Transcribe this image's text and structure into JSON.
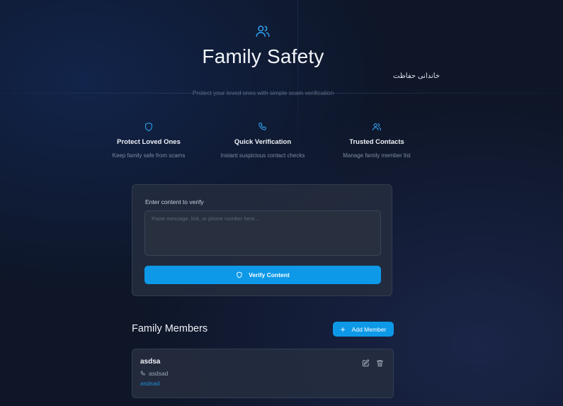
{
  "hero": {
    "icon": "users-icon",
    "title": "Family Safety",
    "title_translation": "خاندانی حفاظت",
    "subtitle": "Protect your loved ones with simple scam verification",
    "accent_color": "#2ea3f2"
  },
  "features": [
    {
      "icon": "shield-icon",
      "title": "Protect Loved Ones",
      "description": "Keep family safe from scams"
    },
    {
      "icon": "phone-icon",
      "title": "Quick Verification",
      "description": "Instant suspicious contact checks"
    },
    {
      "icon": "users-icon",
      "title": "Trusted Contacts",
      "description": "Manage family member list"
    }
  ],
  "verify": {
    "label": "Enter content to verify",
    "placeholder": "Paste message, link, or phone number here...",
    "value": "",
    "button_label": "Verify Content",
    "button_color": "#0d99e8"
  },
  "members": {
    "title": "Family Members",
    "add_button_label": "Add Member",
    "items": [
      {
        "name": "asdsa",
        "phone": "asdsad",
        "relation": "asdsad"
      }
    ]
  }
}
